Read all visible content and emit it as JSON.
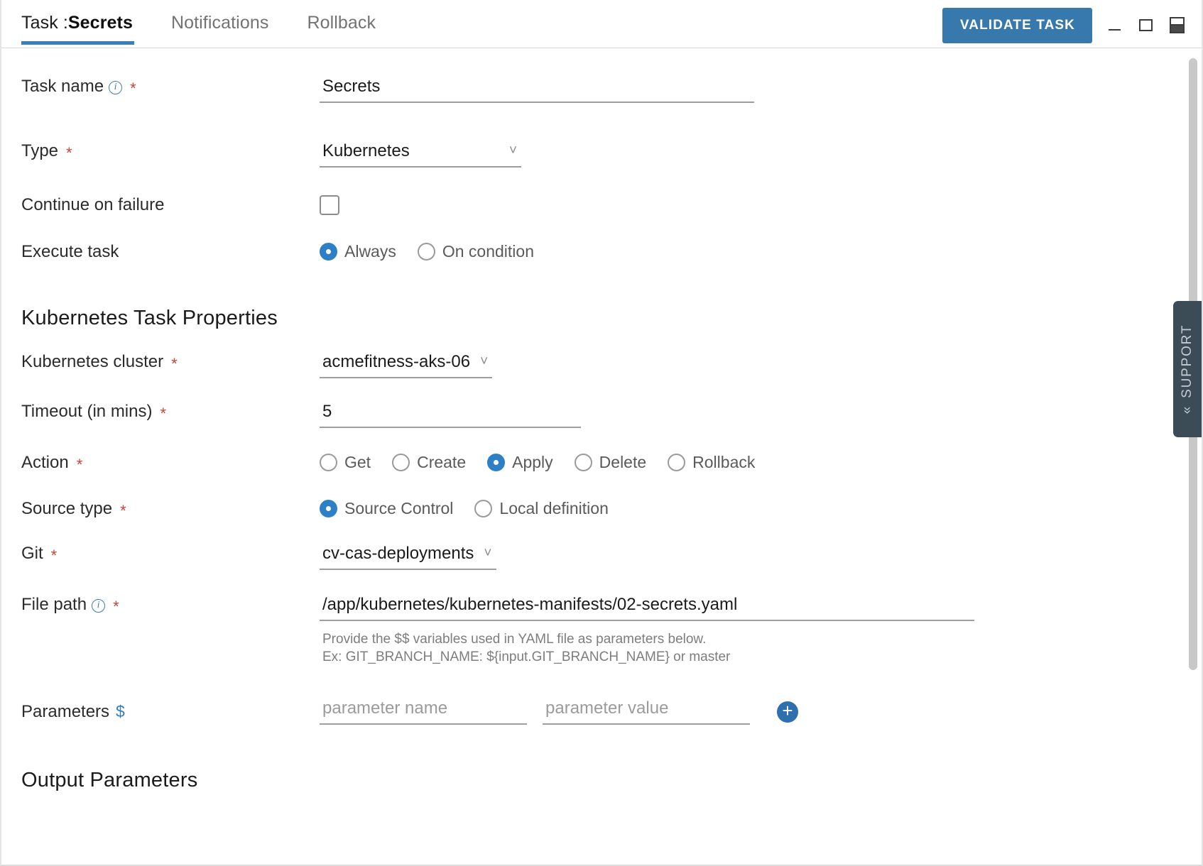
{
  "header": {
    "tabs": [
      {
        "prefix": "Task :",
        "name": "Secrets",
        "active": true
      },
      {
        "label": "Notifications",
        "active": false
      },
      {
        "label": "Rollback",
        "active": false
      }
    ],
    "validate_button": "VALIDATE TASK",
    "window_controls": {
      "minimize": "minimize-icon",
      "maximize": "maximize-icon",
      "split": "split-view-icon"
    },
    "accent_color": "#3778ad"
  },
  "form": {
    "task_name": {
      "label": "Task name",
      "required": "*",
      "info": "i",
      "value": "Secrets"
    },
    "type": {
      "label": "Type",
      "required": "*",
      "value": "Kubernetes",
      "chevron": "chevron-down-icon"
    },
    "continue_on_failure": {
      "label": "Continue on failure",
      "checked": false
    },
    "execute_task": {
      "label": "Execute task",
      "options": [
        "Always",
        "On condition"
      ],
      "selected": "Always"
    }
  },
  "kubernetes_section": {
    "title": "Kubernetes Task Properties",
    "cluster": {
      "label": "Kubernetes cluster",
      "required": "*",
      "value": "acmefitness-aks-06"
    },
    "timeout": {
      "label": "Timeout (in mins)",
      "required": "*",
      "value": "5"
    },
    "action": {
      "label": "Action",
      "required": "*",
      "options": [
        "Get",
        "Create",
        "Apply",
        "Delete",
        "Rollback"
      ],
      "selected": "Apply"
    },
    "source_type": {
      "label": "Source type",
      "required": "*",
      "options": [
        "Source Control",
        "Local definition"
      ],
      "selected": "Source Control"
    },
    "git": {
      "label": "Git",
      "required": "*",
      "value": "cv-cas-deployments"
    },
    "file_path": {
      "label": "File path",
      "required": "*",
      "info": "i",
      "value": "/app/kubernetes/kubernetes-manifests/02-secrets.yaml",
      "hint": "Provide the $$ variables used in YAML file as parameters below.\nEx: GIT_BRANCH_NAME: ${input.GIT_BRANCH_NAME} or master"
    },
    "parameters": {
      "label": "Parameters",
      "dollar": "$",
      "name_placeholder": "parameter name",
      "value_placeholder": "parameter value",
      "add_button": "+"
    }
  },
  "output_parameters": {
    "title": "Output Parameters"
  },
  "support": {
    "label": "SUPPORT",
    "chevron": "«"
  }
}
